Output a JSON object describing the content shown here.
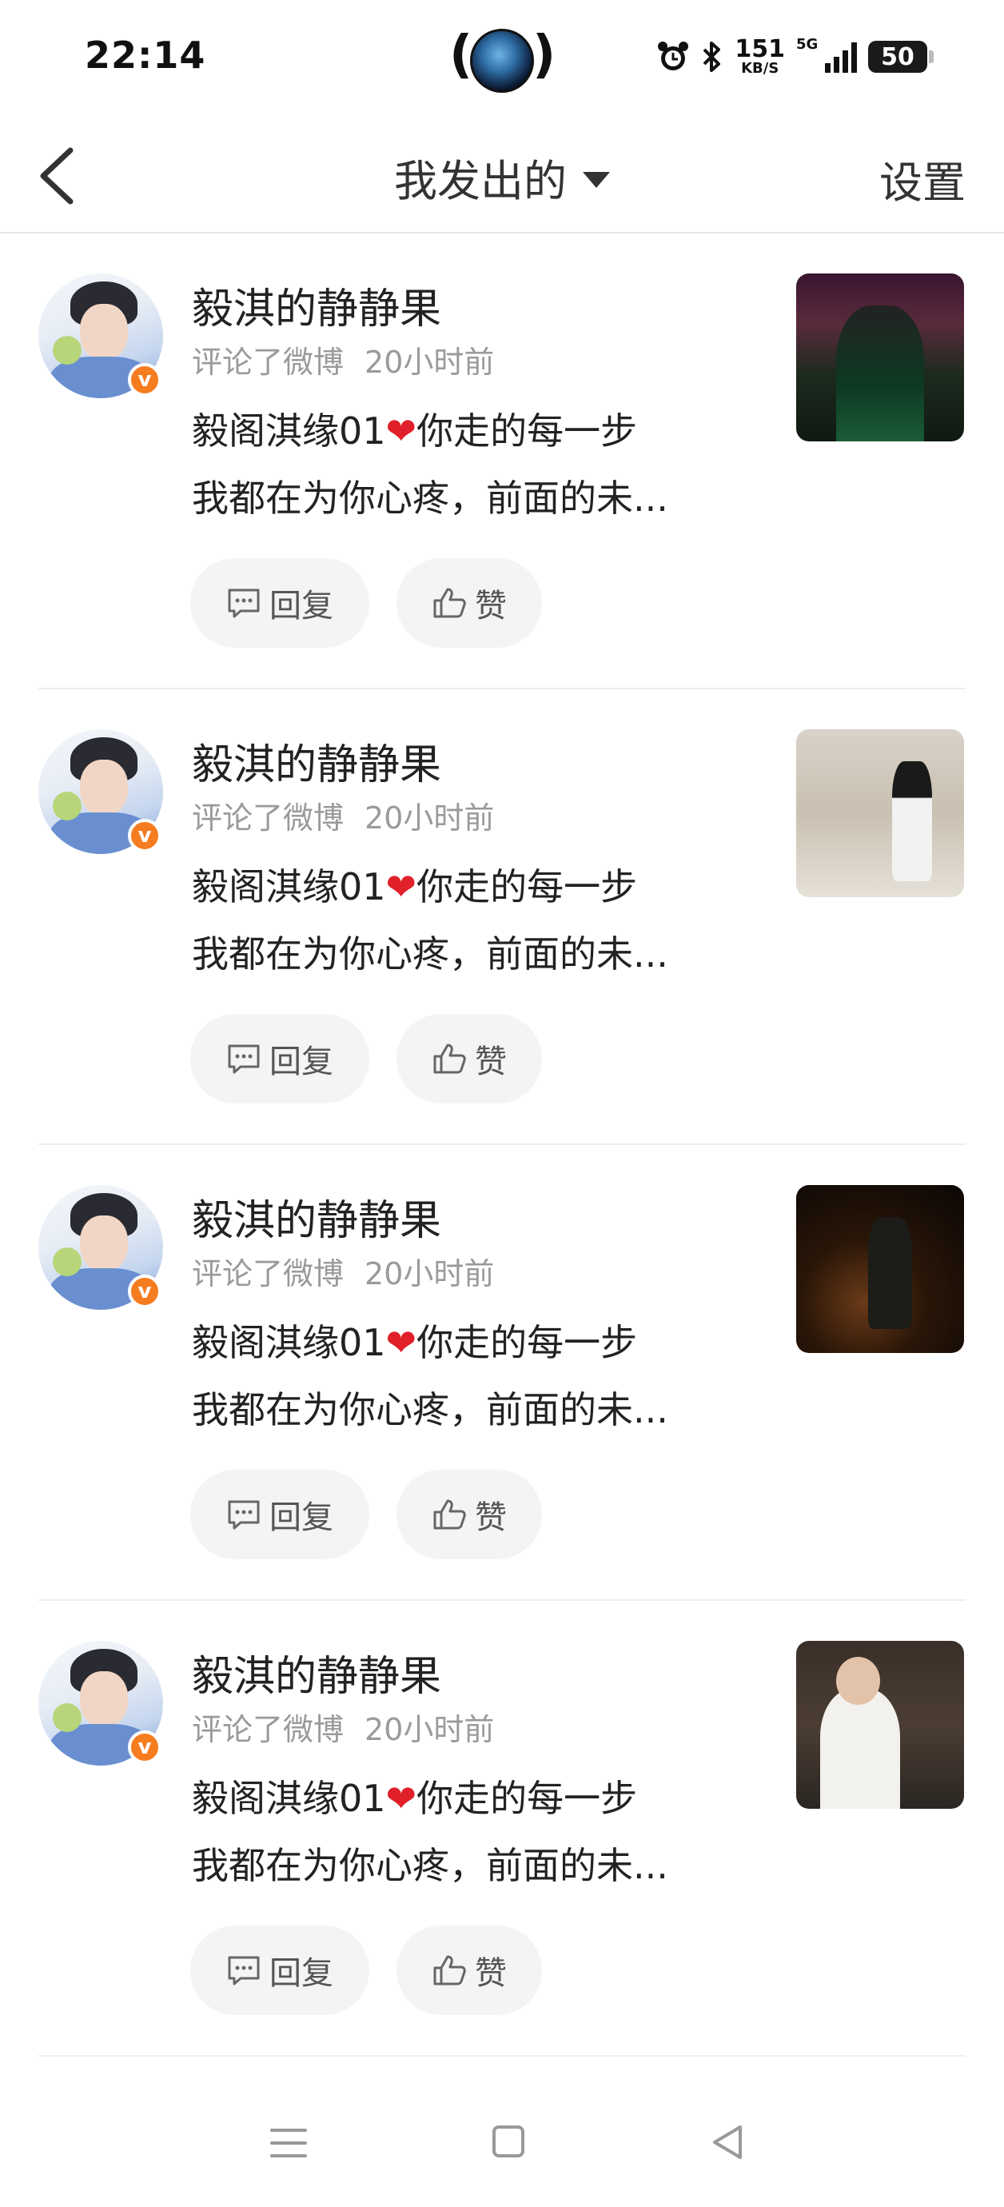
{
  "status_bar": {
    "time": "22:14",
    "net_speed_value": "151",
    "net_speed_unit": "KB/S",
    "network_type": "5G",
    "battery": "50"
  },
  "header": {
    "title": "我发出的",
    "settings_label": "设置"
  },
  "feed": [
    {
      "username": "毅淇的静静果",
      "action": "评论了微博",
      "time_ago": "20小时前",
      "content_part1": "毅阁淇缘01",
      "content_part2": "你走的每一步",
      "content_line2": "我都在为你心疼，前面的未...",
      "reply_label": "回复",
      "like_label": "赞"
    },
    {
      "username": "毅淇的静静果",
      "action": "评论了微博",
      "time_ago": "20小时前",
      "content_part1": "毅阁淇缘01",
      "content_part2": "你走的每一步",
      "content_line2": "我都在为你心疼，前面的未...",
      "reply_label": "回复",
      "like_label": "赞"
    },
    {
      "username": "毅淇的静静果",
      "action": "评论了微博",
      "time_ago": "20小时前",
      "content_part1": "毅阁淇缘01",
      "content_part2": "你走的每一步",
      "content_line2": "我都在为你心疼，前面的未...",
      "reply_label": "回复",
      "like_label": "赞"
    },
    {
      "username": "毅淇的静静果",
      "action": "评论了微博",
      "time_ago": "20小时前",
      "content_part1": "毅阁淇缘01",
      "content_part2": "你走的每一步",
      "content_line2": "我都在为你心疼，前面的未...",
      "reply_label": "回复",
      "like_label": "赞"
    }
  ],
  "icons": {
    "heart": "❤",
    "verified": "v"
  },
  "colors": {
    "verified_badge": "#f57c1f",
    "heart": "#e0202a",
    "meta_text": "#9a9a9a",
    "button_bg": "#f4f4f4"
  }
}
